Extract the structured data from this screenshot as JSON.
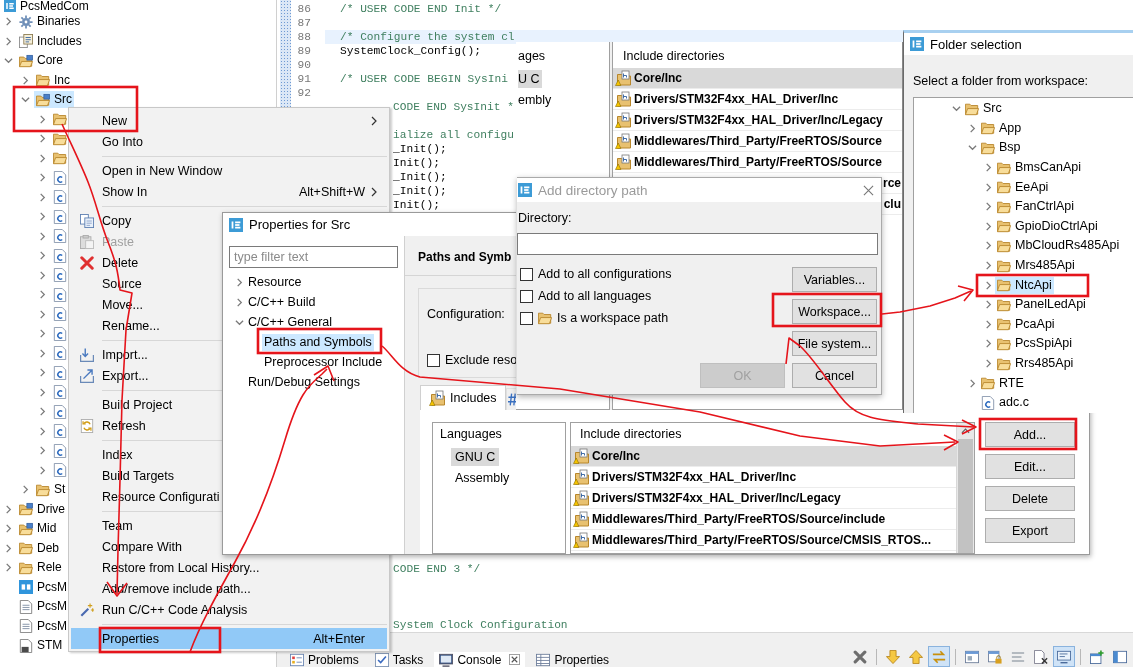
{
  "project_explorer": {
    "project": {
      "label": "PcsMedCom",
      "selected": false
    },
    "items": [
      {
        "label": "Binaries",
        "kind": "binaries",
        "expanded": false,
        "selected": false
      },
      {
        "label": "Includes",
        "kind": "includes",
        "expanded": false,
        "selected": false
      },
      {
        "label": "Core",
        "kind": "source-folder",
        "expanded": true,
        "selected": false,
        "children": [
          {
            "label": "Inc",
            "kind": "folder",
            "expanded": false,
            "selected": false
          },
          {
            "label": "Src",
            "kind": "source-folder",
            "expanded": true,
            "selected": true,
            "children": [
              {
                "kind": "folder",
                "expanded": false,
                "selected": false
              },
              {
                "kind": "folder",
                "expanded": false,
                "selected": false
              },
              {
                "kind": "folder",
                "expanded": false,
                "selected": false
              },
              {
                "kind": "c-file",
                "expanded": false,
                "selected": false
              },
              {
                "kind": "c-file",
                "expanded": false,
                "selected": false
              },
              {
                "kind": "c-file",
                "expanded": false,
                "selected": false
              },
              {
                "kind": "c-file",
                "expanded": false,
                "selected": false
              },
              {
                "kind": "c-file",
                "expanded": false,
                "selected": false
              },
              {
                "kind": "c-file",
                "expanded": false,
                "selected": false
              },
              {
                "kind": "c-file",
                "expanded": false,
                "selected": false
              },
              {
                "kind": "c-file",
                "expanded": false,
                "selected": false
              },
              {
                "kind": "c-file",
                "expanded": false,
                "selected": false
              },
              {
                "kind": "c-file",
                "expanded": false,
                "selected": false
              },
              {
                "kind": "c-file",
                "expanded": false,
                "selected": false
              },
              {
                "kind": "c-file",
                "expanded": false,
                "selected": false
              },
              {
                "kind": "c-file",
                "expanded": false,
                "selected": false
              },
              {
                "kind": "c-file",
                "expanded": false,
                "selected": false
              },
              {
                "kind": "c-file",
                "expanded": false,
                "selected": false
              },
              {
                "kind": "c-file",
                "expanded": false,
                "selected": false
              }
            ]
          },
          {
            "label": "St",
            "kind": "folder",
            "expanded": false,
            "selected": false
          }
        ]
      },
      {
        "label": "Drive",
        "kind": "source-folder",
        "expanded": false,
        "selected": false
      },
      {
        "label": "Mid",
        "kind": "source-folder",
        "expanded": false,
        "selected": false
      },
      {
        "label": "Deb",
        "kind": "folder",
        "expanded": false,
        "selected": false
      },
      {
        "label": "Rele",
        "kind": "folder",
        "expanded": false,
        "selected": false
      },
      {
        "label": "PcsM",
        "kind": "mx-file",
        "selected": false
      },
      {
        "label": "PcsM",
        "kind": "text-file",
        "selected": false
      },
      {
        "label": "PcsM",
        "kind": "text-file",
        "selected": false
      },
      {
        "label": "STM",
        "kind": "linker-file",
        "selected": false
      }
    ]
  },
  "editor": {
    "lines": [
      {
        "number": "86",
        "text": "/* USER CODE END Init */",
        "kind": "comment",
        "current": false
      },
      {
        "number": "87",
        "current": false
      },
      {
        "number": "88",
        "text": "/* Configure the system cl",
        "kind": "comment",
        "current": true
      },
      {
        "number": "89",
        "text": "SystemClock_Config();",
        "kind": "code",
        "current": false
      },
      {
        "number": "90",
        "current": false
      },
      {
        "number": "91",
        "text": "/* USER CODE BEGIN SysIni",
        "kind": "comment",
        "current": false
      },
      {
        "number": "92",
        "current": false
      }
    ],
    "lines_right_of_menu": [
      {
        "text": "CODE END SysInit *",
        "kind": "comment"
      },
      {
        "text": "ialize all configu",
        "kind": "comment"
      },
      {
        "text": "_Init();",
        "kind": "code"
      },
      {
        "text": "Init();",
        "kind": "code"
      },
      {
        "text": "_Init();",
        "kind": "code"
      },
      {
        "text": "_Init();",
        "kind": "code"
      },
      {
        "text": "Init();",
        "kind": "code"
      }
    ],
    "lines_below_dialogs": [
      {
        "text": "CODE END 3 */",
        "kind": "comment"
      },
      {
        "text": "System Clock Configuration",
        "kind": "comment"
      }
    ]
  },
  "context_menu": {
    "items": [
      {
        "kind": "item",
        "label": "New",
        "submenu": true,
        "disabled": false,
        "selected": false
      },
      {
        "kind": "item",
        "label": "Go Into",
        "submenu": false,
        "disabled": false,
        "selected": false
      },
      {
        "kind": "separator"
      },
      {
        "kind": "item",
        "label": "Open in New Window",
        "submenu": false,
        "disabled": false,
        "selected": false
      },
      {
        "kind": "item",
        "label": "Show In",
        "shortcut": "Alt+Shift+W",
        "submenu": true,
        "disabled": false,
        "selected": false
      },
      {
        "kind": "separator"
      },
      {
        "kind": "item",
        "label": "Copy",
        "submenu": false,
        "disabled": false,
        "selected": false
      },
      {
        "kind": "item",
        "label": "Paste",
        "submenu": false,
        "disabled": true,
        "selected": false
      },
      {
        "kind": "item",
        "label": "Delete",
        "submenu": false,
        "disabled": false,
        "selected": false
      },
      {
        "kind": "item",
        "label": "Source",
        "submenu": false,
        "disabled": false,
        "selected": false
      },
      {
        "kind": "item",
        "label": "Move...",
        "submenu": false,
        "disabled": false,
        "selected": false
      },
      {
        "kind": "item",
        "label": "Rename...",
        "submenu": false,
        "disabled": false,
        "selected": false
      },
      {
        "kind": "separator"
      },
      {
        "kind": "item",
        "label": "Import...",
        "submenu": false,
        "disabled": false,
        "selected": false
      },
      {
        "kind": "item",
        "label": "Export...",
        "submenu": false,
        "disabled": false,
        "selected": false
      },
      {
        "kind": "separator"
      },
      {
        "kind": "item",
        "label": "Build Project",
        "submenu": false,
        "disabled": false,
        "selected": false
      },
      {
        "kind": "item",
        "label": "Refresh",
        "submenu": false,
        "disabled": false,
        "selected": false
      },
      {
        "kind": "separator"
      },
      {
        "kind": "item",
        "label": "Index",
        "submenu": false,
        "disabled": false,
        "selected": false
      },
      {
        "kind": "item",
        "label": "Build Targets",
        "submenu": false,
        "disabled": false,
        "selected": false
      },
      {
        "kind": "item",
        "label": "Resource Configurati",
        "submenu": false,
        "disabled": false,
        "selected": false
      },
      {
        "kind": "separator"
      },
      {
        "kind": "item",
        "label": "Team",
        "submenu": false,
        "disabled": false,
        "selected": false
      },
      {
        "kind": "item",
        "label": "Compare With",
        "submenu": false,
        "disabled": false,
        "selected": false
      },
      {
        "kind": "item",
        "label": "Restore from Local History...",
        "submenu": false,
        "disabled": false,
        "selected": false
      },
      {
        "kind": "item",
        "label": "Add/remove include path...",
        "submenu": false,
        "disabled": false,
        "selected": false
      },
      {
        "kind": "item",
        "label": "Run C/C++ Code Analysis",
        "submenu": false,
        "disabled": false,
        "selected": false
      },
      {
        "kind": "separator"
      },
      {
        "kind": "item",
        "label": "Properties",
        "shortcut": "Alt+Enter",
        "submenu": false,
        "disabled": false,
        "selected": true
      }
    ]
  },
  "properties_window": {
    "title": "Properties for Src",
    "filter": {
      "placeholder": "type filter text"
    },
    "tree": [
      {
        "label": "Resource",
        "expanded": false,
        "selected": false
      },
      {
        "label": "C/C++ Build",
        "expanded": false,
        "selected": false
      },
      {
        "label": "C/C++ General",
        "expanded": true,
        "selected": false,
        "children": [
          {
            "label": "Paths and Symbols",
            "selected": true
          },
          {
            "label": "Preprocessor Include",
            "selected": false
          }
        ]
      },
      {
        "label": "Run/Debug Settings",
        "selected": false
      }
    ],
    "page_title": "Paths and Symb",
    "configuration_label": "Configuration:",
    "exclude": {
      "label": "Exclude reso",
      "checked": false
    },
    "tabs": [
      {
        "label": "Includes",
        "selected": true
      },
      {
        "selected": false
      }
    ],
    "languages": {
      "heading": "Languages",
      "items": [
        {
          "label": "GNU C",
          "selected": true
        },
        {
          "label": "Assembly",
          "selected": false
        }
      ]
    },
    "include_directories": {
      "heading": "Include directories",
      "items": [
        {
          "label": "Core/Inc",
          "kind": "path",
          "selected": true
        },
        {
          "label": "Drivers/STM32F4xx_HAL_Driver/Inc",
          "kind": "path",
          "selected": false
        },
        {
          "label": "Drivers/STM32F4xx_HAL_Driver/Inc/Legacy",
          "kind": "path",
          "selected": false
        },
        {
          "label": "Middlewares/Third_Party/FreeRTOS/Source/include",
          "kind": "path",
          "selected": false
        },
        {
          "label": "Middlewares/Third_Party/FreeRTOS/Source/CMSIS_RTOS...",
          "kind": "path",
          "selected": false
        }
      ]
    },
    "buttons": [
      {
        "label": "Add..."
      },
      {
        "label": "Edit..."
      },
      {
        "label": "Delete"
      },
      {
        "label": "Export"
      }
    ]
  },
  "paths_panel_behind": {
    "languages": {
      "heading": "ages",
      "items": [
        {
          "label": "U C",
          "selected": true
        },
        {
          "label": "embly",
          "selected": false
        }
      ]
    },
    "include_directories": {
      "heading": "Include directories",
      "items": [
        {
          "label": "Core/Inc",
          "kind": "path",
          "selected": true
        },
        {
          "label": "Drivers/STM32F4xx_HAL_Driver/Inc",
          "kind": "path",
          "selected": false
        },
        {
          "label": "Drivers/STM32F4xx_HAL_Driver/Inc/Legacy",
          "kind": "path",
          "selected": false
        },
        {
          "label": "Middlewares/Third_Party/FreeRTOS/Source",
          "kind": "path",
          "selected": false
        },
        {
          "label": "Middlewares/Third_Party/FreeRTOS/Source",
          "kind": "path",
          "selected": false
        },
        {
          "label": "rce",
          "kind": "clipped",
          "selected": false
        },
        {
          "label": "clu",
          "kind": "clipped",
          "selected": false
        }
      ]
    }
  },
  "add_directory_dialog": {
    "title": "Add directory path",
    "directory_label": "Directory:",
    "checkboxes": [
      {
        "label": "Add to all configurations",
        "checked": false
      },
      {
        "label": "Add to all languages",
        "checked": false
      },
      {
        "label": "Is a workspace path",
        "checked": false
      }
    ],
    "buttons": [
      {
        "label": "Variables...",
        "disabled": false
      },
      {
        "label": "Workspace...",
        "disabled": false
      },
      {
        "label": "File system...",
        "disabled": false
      },
      {
        "label": "OK",
        "disabled": true
      },
      {
        "label": "Cancel",
        "disabled": false
      }
    ]
  },
  "folder_selection": {
    "title": "Folder selection",
    "prompt": "Select a folder from workspace:",
    "tree": [
      {
        "label": "Src",
        "kind": "folder",
        "expanded": true,
        "selected": false,
        "children": [
          {
            "label": "App",
            "kind": "folder",
            "expanded": false,
            "selected": false
          },
          {
            "label": "Bsp",
            "kind": "folder",
            "expanded": true,
            "selected": false,
            "children": [
              {
                "label": "BmsCanApi",
                "kind": "folder",
                "expanded": false,
                "selected": false
              },
              {
                "label": "EeApi",
                "kind": "folder",
                "expanded": false,
                "selected": false
              },
              {
                "label": "FanCtrlApi",
                "kind": "folder",
                "expanded": false,
                "selected": false
              },
              {
                "label": "GpioDioCtrlApi",
                "kind": "folder",
                "expanded": false,
                "selected": false
              },
              {
                "label": "MbCloudRs485Api",
                "kind": "folder",
                "expanded": false,
                "selected": false
              },
              {
                "label": "Mrs485Api",
                "kind": "folder",
                "expanded": false,
                "selected": false
              },
              {
                "label": "NtcApi",
                "kind": "folder",
                "expanded": false,
                "selected": true
              },
              {
                "label": "PanelLedApi",
                "kind": "folder",
                "expanded": false,
                "selected": false
              },
              {
                "label": "PcaApi",
                "kind": "folder",
                "expanded": false,
                "selected": false
              },
              {
                "label": "PcsSpiApi",
                "kind": "folder",
                "expanded": false,
                "selected": false
              },
              {
                "label": "Rrs485Api",
                "kind": "folder",
                "expanded": false,
                "selected": false
              }
            ]
          },
          {
            "label": "RTE",
            "kind": "folder",
            "expanded": false,
            "selected": false
          },
          {
            "label": "adc.c",
            "kind": "c-file",
            "selected": false
          }
        ]
      }
    ]
  },
  "bottom_panel": {
    "tabs": [
      {
        "label": "Problems",
        "selected": false
      },
      {
        "label": "Tasks",
        "selected": false
      },
      {
        "label": "Console",
        "selected": true
      },
      {
        "label": "Properties",
        "selected": false
      }
    ],
    "toolbar": [
      {
        "pressed": false
      },
      {
        "pressed": false
      },
      {
        "pressed": false
      },
      {
        "pressed": true
      },
      {
        "pressed": false
      },
      {
        "pressed": false
      },
      {
        "pressed": false
      },
      {
        "pressed": false
      },
      {
        "pressed": true
      },
      {
        "pressed": false
      },
      {
        "pressed": false
      }
    ]
  },
  "annotations": [
    {
      "kind": "frame"
    },
    {
      "kind": "arrow"
    },
    {
      "kind": "frame"
    },
    {
      "kind": "arrow"
    },
    {
      "kind": "frame"
    },
    {
      "kind": "arrow"
    },
    {
      "kind": "frame"
    },
    {
      "kind": "arrow"
    },
    {
      "kind": "arrow"
    },
    {
      "kind": "frame"
    },
    {
      "kind": "frame"
    }
  ]
}
